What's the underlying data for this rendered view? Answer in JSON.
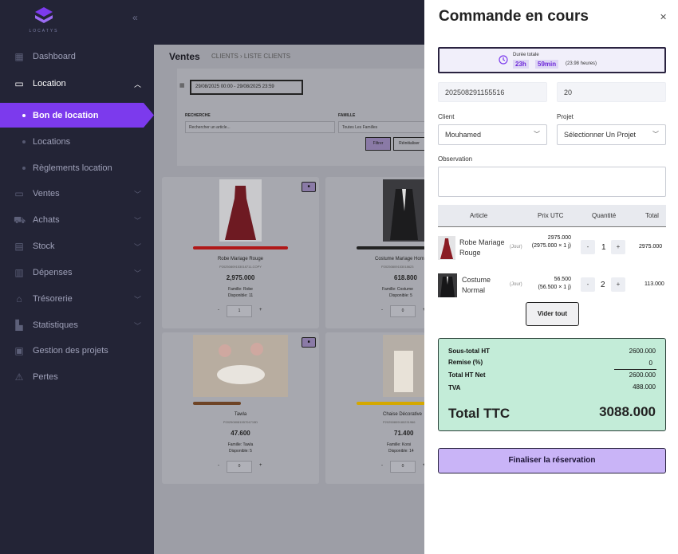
{
  "sidebar": {
    "logo_text": "LOCATYS",
    "items": [
      {
        "label": "Dashboard",
        "icon": "grid-icon"
      },
      {
        "label": "Location",
        "icon": "cash-icon"
      },
      {
        "label": "Ventes",
        "icon": "money-icon"
      },
      {
        "label": "Achats",
        "icon": "cart-icon"
      },
      {
        "label": "Stock",
        "icon": "boxes-icon"
      },
      {
        "label": "Dépenses",
        "icon": "expense-icon"
      },
      {
        "label": "Trésorerie",
        "icon": "bank-icon"
      },
      {
        "label": "Statistiques",
        "icon": "chart-icon"
      },
      {
        "label": "Gestion des projets",
        "icon": "projects-icon"
      },
      {
        "label": "Pertes",
        "icon": "warning-icon"
      }
    ],
    "sub_items": [
      {
        "label": "Bon de location"
      },
      {
        "label": "Locations"
      },
      {
        "label": "Règlements location"
      }
    ]
  },
  "main": {
    "title": "Ventes",
    "breadcrumb": "CLIENTS › LISTE CLIENTS",
    "date_range": "29/08/2025 00:00 - 29/08/2025 23:59",
    "search_label": "RECHERCHE",
    "search_placeholder": "Rechercher un article...",
    "family_label": "FAMILLE",
    "family_value": "Toutes Les Familles",
    "filter_button": "Filtrer",
    "reset_button": "Réinitialiser",
    "products": [
      {
        "name": "Robe Mariage Rouge",
        "code": "P20250809153018711-COPY",
        "price": "2,975.000",
        "family": "Famille: Robe",
        "available": "Disponible: 11",
        "qty": "1",
        "bar_color": "#d11a1a"
      },
      {
        "name": "Costume Mariage Homme",
        "code": "P20250809153018623",
        "price": "618.800",
        "family": "Famille: Costume",
        "available": "Disponible: 5",
        "qty": "0",
        "bar_color": "#222222"
      },
      {
        "name": "Tawla",
        "code": "P20250808155704715D",
        "price": "47.600",
        "family": "Famille: Tawla",
        "available": "Disponible: 5",
        "qty": "0",
        "bar_color": "#7a4a2a"
      },
      {
        "name": "Chaise Décorative",
        "code": "P20250809180231966",
        "price": "71.400",
        "family": "Famille: Korsi",
        "available": "Disponible: 14",
        "qty": "0",
        "bar_color": "#e6b800"
      }
    ]
  },
  "panel": {
    "title": "Commande en cours",
    "duration_label": "Durée totale",
    "duration_hours": "23h",
    "duration_minutes": "59min",
    "duration_total": "(23.98 heures)",
    "order_number": "202508291155516",
    "order_qty": "20",
    "client_label": "Client",
    "client_value": "Mouhamed",
    "project_label": "Projet",
    "project_value": "Sélectionner Un Projet",
    "observation_label": "Observation",
    "table_headers": [
      "Article",
      "Prix UTC",
      "Quantité",
      "Total"
    ],
    "rows": [
      {
        "name": "Robe Mariage Rouge",
        "unit": "(Jour)",
        "price": "2975.000",
        "detail": "(2975.000 × 1 j)",
        "qty": "1",
        "total": "2975.000"
      },
      {
        "name": "Costume Normal",
        "unit": "(Jour)",
        "price": "56.500",
        "detail": "(56.500 × 1 j)",
        "qty": "2",
        "total": "113.000"
      }
    ],
    "clear_button": "Vider tout",
    "summary": {
      "subtotal_label": "Sous-total HT",
      "subtotal": "2600.000",
      "discount_label": "Remise (%)",
      "discount": "0",
      "net_label": "Total HT Net",
      "net": "2600.000",
      "tva_label": "TVA",
      "tva": "488.000",
      "ttc_label": "Total TTC",
      "ttc": "3088.000"
    },
    "finalize_button": "Finaliser la réservation"
  }
}
